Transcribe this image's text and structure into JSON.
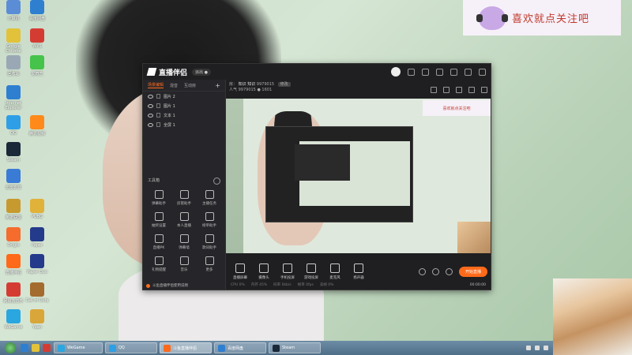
{
  "desktop": {
    "icons": [
      {
        "label": "计算机",
        "color": "#5b8dd6"
      },
      {
        "label": "Google Chrome",
        "color": "#e2c23a"
      },
      {
        "label": "回收站",
        "color": "#9aa8b5"
      },
      {
        "label": "Internet Explorer",
        "color": "#2f7fd1"
      },
      {
        "label": "QQ",
        "color": "#2e9fe6"
      },
      {
        "label": "Steam",
        "color": "#1b2838"
      },
      {
        "label": "迅雷影音",
        "color": "#3a7bd5"
      },
      {
        "label": "英雄联盟",
        "color": "#c79a2f"
      },
      {
        "label": "Origin",
        "color": "#f56c2d"
      },
      {
        "label": "直播伴侣",
        "color": "#ff6a1a"
      },
      {
        "label": "网易云音乐",
        "color": "#d43c33"
      },
      {
        "label": "WeGame",
        "color": "#2aa7e0"
      }
    ],
    "icons_col2": [
      {
        "label": "百度网盘",
        "color": "#2f7fd1"
      },
      {
        "label": "WPS",
        "color": "#d43c33"
      },
      {
        "label": "爱奇艺",
        "color": "#46c34a"
      },
      {
        "label": "腾讯视频",
        "color": "#ff8a1a"
      },
      {
        "label": "PUBG",
        "color": "#e0b23a"
      },
      {
        "label": "Paper",
        "color": "#243a8a"
      },
      {
        "label": "Paper Duo",
        "color": "#243a8a"
      },
      {
        "label": "Call of Duty",
        "color": "#a46b2e"
      },
      {
        "label": "Yuan",
        "color": "#d9a63a"
      }
    ]
  },
  "banner": {
    "text": "喜欢就点关注吧"
  },
  "app": {
    "title": "直播伴侣",
    "tag": "派出 ●",
    "left_tabs": [
      "场景编辑",
      "混音",
      "互动房"
    ],
    "layers": [
      "图片 2",
      "图片 1",
      "文本 1",
      "全屏 1"
    ],
    "toolbox_title": "工具箱",
    "tools": [
      "弹幕助手",
      "房管助手",
      "主播任务",
      "抽奖设置",
      "本人直播",
      "榜单助手",
      "直播PK",
      "弹幕墙",
      "歌词助手",
      "礼物提醒",
      "音乐",
      "更多"
    ],
    "left_footer": "斗鱼直播伴侣使用说明",
    "room_label": "房：",
    "room_name": "知识 知识",
    "room_id": "9979015",
    "room_edit": "修改",
    "room_line2": "人气 9979015 ● 1601",
    "preview_banner": "喜欢就点关注吧",
    "controls": [
      "直播屏幕",
      "摄像头",
      "手机投屏",
      "游戏投屏",
      "麦克风",
      "扬声器"
    ],
    "start_button": "开始直播",
    "status_items": [
      "CPU 0%",
      "内存 45%",
      "码率 0kb/s",
      "帧率 0fps",
      "丢帧 0%"
    ],
    "timer": "00:00:00"
  },
  "taskbar": {
    "tasks": [
      {
        "label": "WeGame",
        "color": "#2aa7e0"
      },
      {
        "label": "QQ",
        "color": "#2e9fe6"
      },
      {
        "label": "斗鱼直播伴侣",
        "color": "#ff6a1a",
        "active": true
      },
      {
        "label": "百度网盘",
        "color": "#2f7fd1"
      },
      {
        "label": "Steam",
        "color": "#1b2838"
      }
    ]
  },
  "colors": {
    "accent": "#ff6a1a",
    "app_bg": "#1f1f22"
  }
}
